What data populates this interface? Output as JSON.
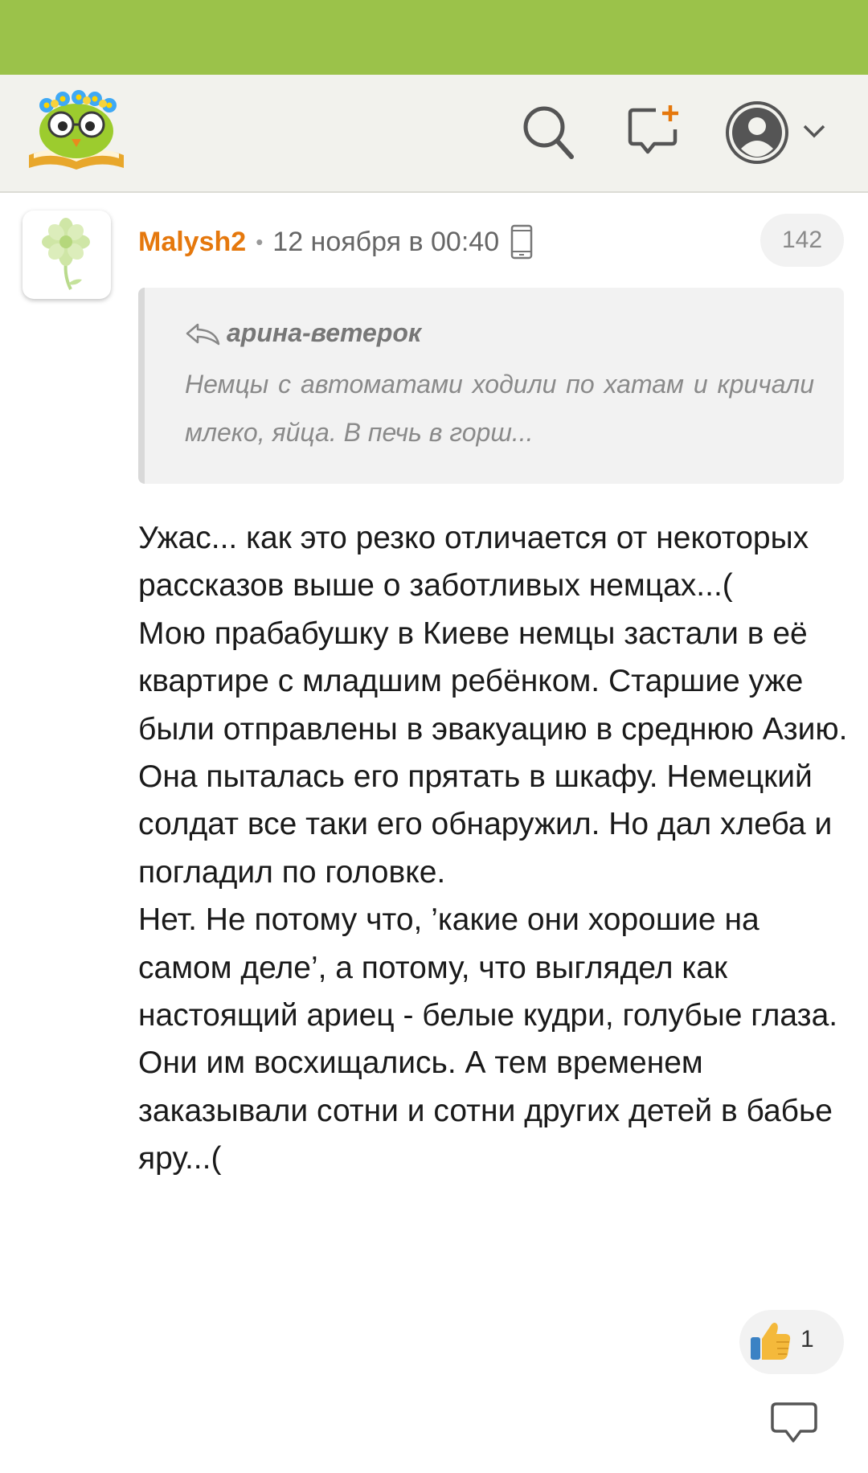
{
  "colors": {
    "status_bar": "#9bc24a",
    "app_bar": "#f2f2ed",
    "author": "#e5780d",
    "quote_bg": "#f2f2f2"
  },
  "header": {
    "logo": "owl-on-book-logo",
    "icons": [
      "search-icon",
      "new-comment-icon",
      "profile-icon",
      "chevron-down-icon"
    ]
  },
  "comment": {
    "author": "Malysh2",
    "separator": "•",
    "date": "12 ноября в 00:40",
    "device_icon": "phone-icon",
    "count": "142",
    "quote": {
      "author": "арина-ветерок",
      "text": "Немцы с автоматами ходили по хатам и кричали млеко, яйца. В печь в горш..."
    },
    "paragraphs": [
      "Ужас... как это резко отличается от некоторых рассказов выше о заботливых немцах...(",
      "Мою прабабушку в Киеве немцы застали в её квартире с младшим ребёнком. Старшие уже были отправлены в эвакуацию в среднюю Азию. Она пыталась его прятать в шкафу. Немецкий солдат все таки его обнаружил. Но дал хлеба и погладил по головке.",
      "Нет. Не потому что, ’какие они хорошие на самом деле’, а потому, что выглядел как настоящий ариец - белые кудри, голубые глаза. Они им восхищались. А тем временем заказывали сотни и сотни других детей в бабье яру...("
    ],
    "likes": "1"
  }
}
